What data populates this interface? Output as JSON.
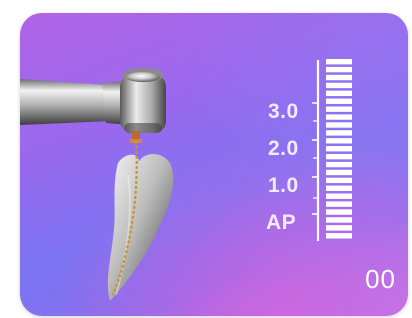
{
  "apex_scale": {
    "labels": [
      "3.0",
      "2.0",
      "1.0",
      "AP"
    ],
    "segment_count": 23
  },
  "counter": {
    "value": "00"
  },
  "colors": {
    "accent_purple": "#9a68ee",
    "accent_magenta": "#d460da",
    "scale_white": "#ffffff"
  },
  "icons": {
    "handpiece": "dental-handpiece-icon",
    "tooth": "tooth-root-canal-icon"
  }
}
